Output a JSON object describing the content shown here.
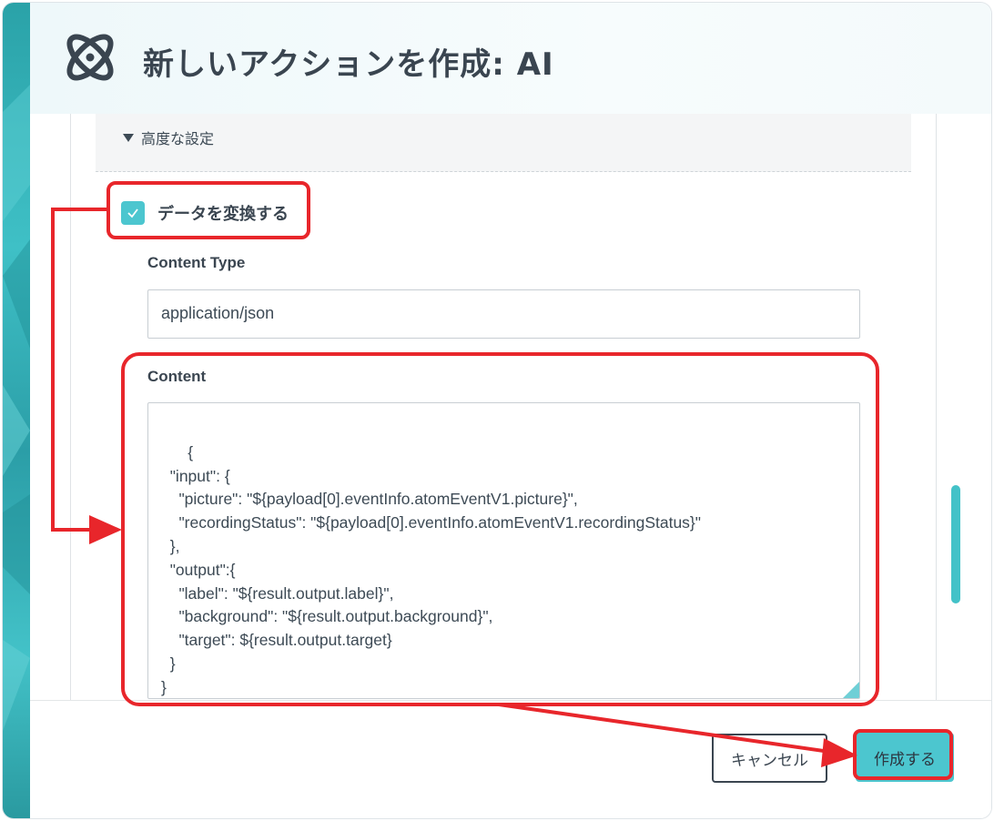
{
  "dialog": {
    "title": "新しいアクションを作成: AI",
    "logo_icon": "atom-icon"
  },
  "advanced": {
    "label": "高度な設定",
    "icon": "caret-down-icon",
    "expanded": true
  },
  "transform": {
    "checkbox_label": "データを変換する",
    "checked": true
  },
  "content_type": {
    "label": "Content Type",
    "value": "application/json"
  },
  "content": {
    "label": "Content",
    "value": "{\n  \"input\": {\n    \"picture\": \"${payload[0].eventInfo.atomEventV1.picture}\",\n    \"recordingStatus\": \"${payload[0].eventInfo.atomEventV1.recordingStatus}\"\n  },\n  \"output\":{\n    \"label\": \"${result.output.label}\",\n    \"background\": \"${result.output.background}\",\n    \"target\": ${result.output.target}\n  }\n}"
  },
  "buttons": {
    "cancel": "キャンセル",
    "create": "作成する"
  },
  "colors": {
    "accent": "#4cc6cf",
    "annotation": "#e8262b",
    "text": "#3a4550"
  }
}
